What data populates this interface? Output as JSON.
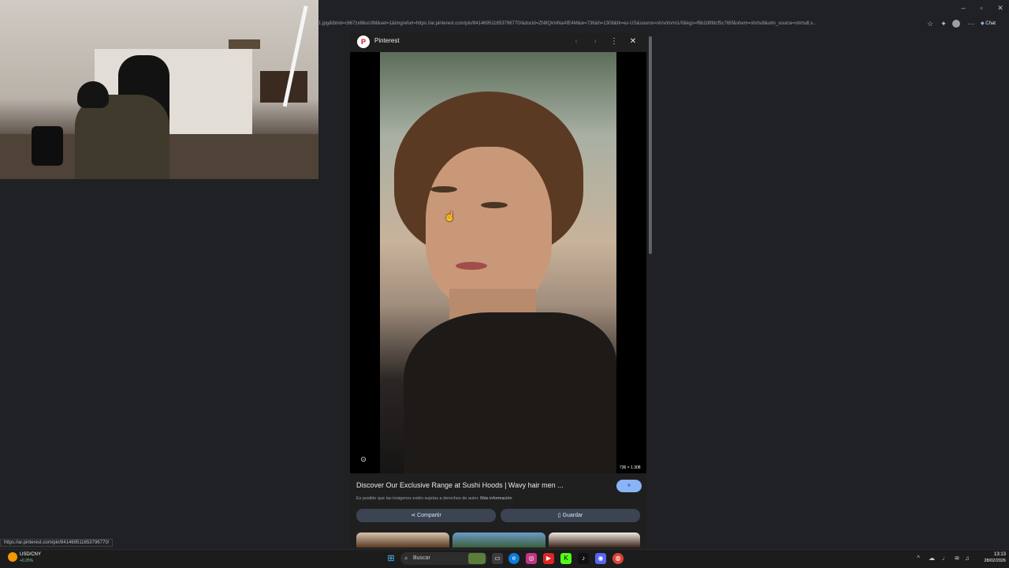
{
  "browser": {
    "url": "1.jpg&tbnid=c667zxl8ksUtM&vet=1&imgrefurl=https://ar.pinterest.com/pin/841469511653796770/&docid=ZN8QtmiNaAfE4M&w=736&h=1308&hl=es-US&source=sh/x/im/m1/0&kgs=f6b2d9fdcf5c765f&shem=shrtsdl&utm_source=shrtsdl,s...",
    "chat_label": "Chat",
    "status_url": "https://ar.pinterest.com/pin/841469511653796770/"
  },
  "panel": {
    "source": "Pinterest",
    "image_dims": "736 × 1.308",
    "title": "Discover Our Exclusive Range at Sushi Hoods | Wavy hair men ...",
    "visit_label": "»",
    "notice": "Es posible que las imágenes estén sujetas a derechos de autor.",
    "more_info": "Más información",
    "share_label": "Compartir",
    "save_label": "Guardar"
  },
  "taskbar": {
    "ticker_name": "USD/CNY",
    "ticker_change": "+0.25%",
    "search_placeholder": "Buscar",
    "time": "13:13",
    "date": "28/02/2026"
  },
  "icons": {
    "start": "windows-icon",
    "search": "search-icon",
    "share": "share-icon",
    "save": "bookmark-icon"
  },
  "colors": {
    "accent": "#8ab4f8",
    "pinterest": "#e60023",
    "action_button": "#3c4452"
  }
}
